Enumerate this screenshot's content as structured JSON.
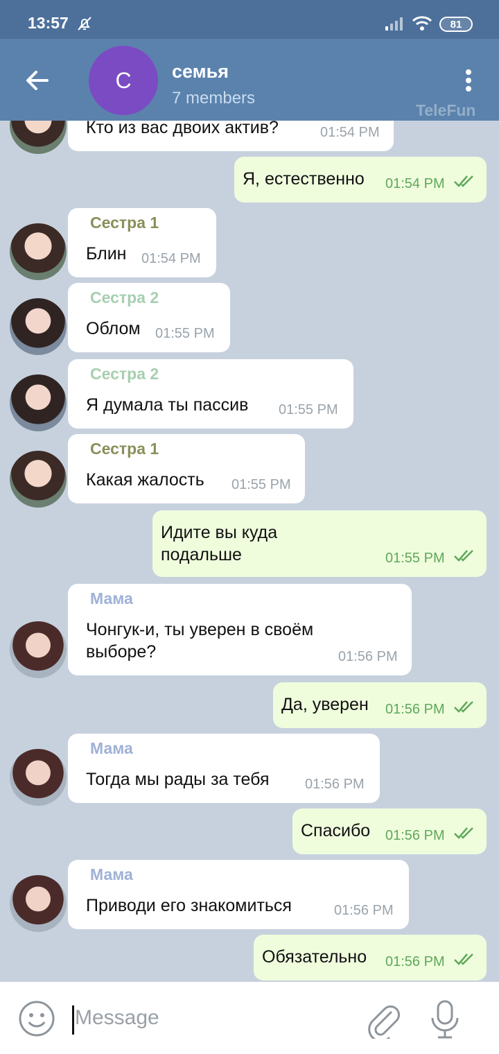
{
  "status_bar": {
    "time": "13:57",
    "battery": "81"
  },
  "header": {
    "avatar_letter": "С",
    "title": "семья",
    "subtitle": "7 members",
    "watermark": "TeleFun",
    "avatar_color": "#7b4bc4"
  },
  "colors": {
    "sister1": "#8a8f5a",
    "sister2": "#a6cfb0",
    "mom": "#9fb1d6",
    "outgoing_bubble": "#effddd",
    "incoming_bubble": "#ffffff",
    "tick": "#5fa85a"
  },
  "messages": [
    {
      "text": "Кто из вас двоих актив?",
      "time": "01:54 PM"
    },
    {
      "text": "Я, естественно",
      "time": "01:54 PM"
    },
    {
      "sender": "Сестра 1",
      "text": "Блин",
      "time": "01:54 PM"
    },
    {
      "sender": "Сестра 2",
      "text": "Облом",
      "time": "01:55 PM"
    },
    {
      "sender": "Сестра 2",
      "text": "Я думала ты пассив",
      "time": "01:55 PM"
    },
    {
      "sender": "Сестра 1",
      "text": "Какая жалость",
      "time": "01:55 PM"
    },
    {
      "text_line1": "Идите вы куда",
      "text_line2": "подальше",
      "time": "01:55 PM"
    },
    {
      "sender": "Мама",
      "text_line1": "Чонгук-и, ты уверен в своём",
      "text_line2": "выборе?",
      "time": "01:56 PM"
    },
    {
      "text": "Да, уверен",
      "time": "01:56 PM"
    },
    {
      "sender": "Мама",
      "text": "Тогда мы рады за тебя",
      "time": "01:56 PM"
    },
    {
      "text": "Спасибо",
      "time": "01:56 PM"
    },
    {
      "sender": "Мама",
      "text": "Приводи его знакомиться",
      "time": "01:56 PM"
    },
    {
      "text": "Обязательно",
      "time": "01:56 PM"
    }
  ],
  "input": {
    "placeholder": "Message"
  }
}
